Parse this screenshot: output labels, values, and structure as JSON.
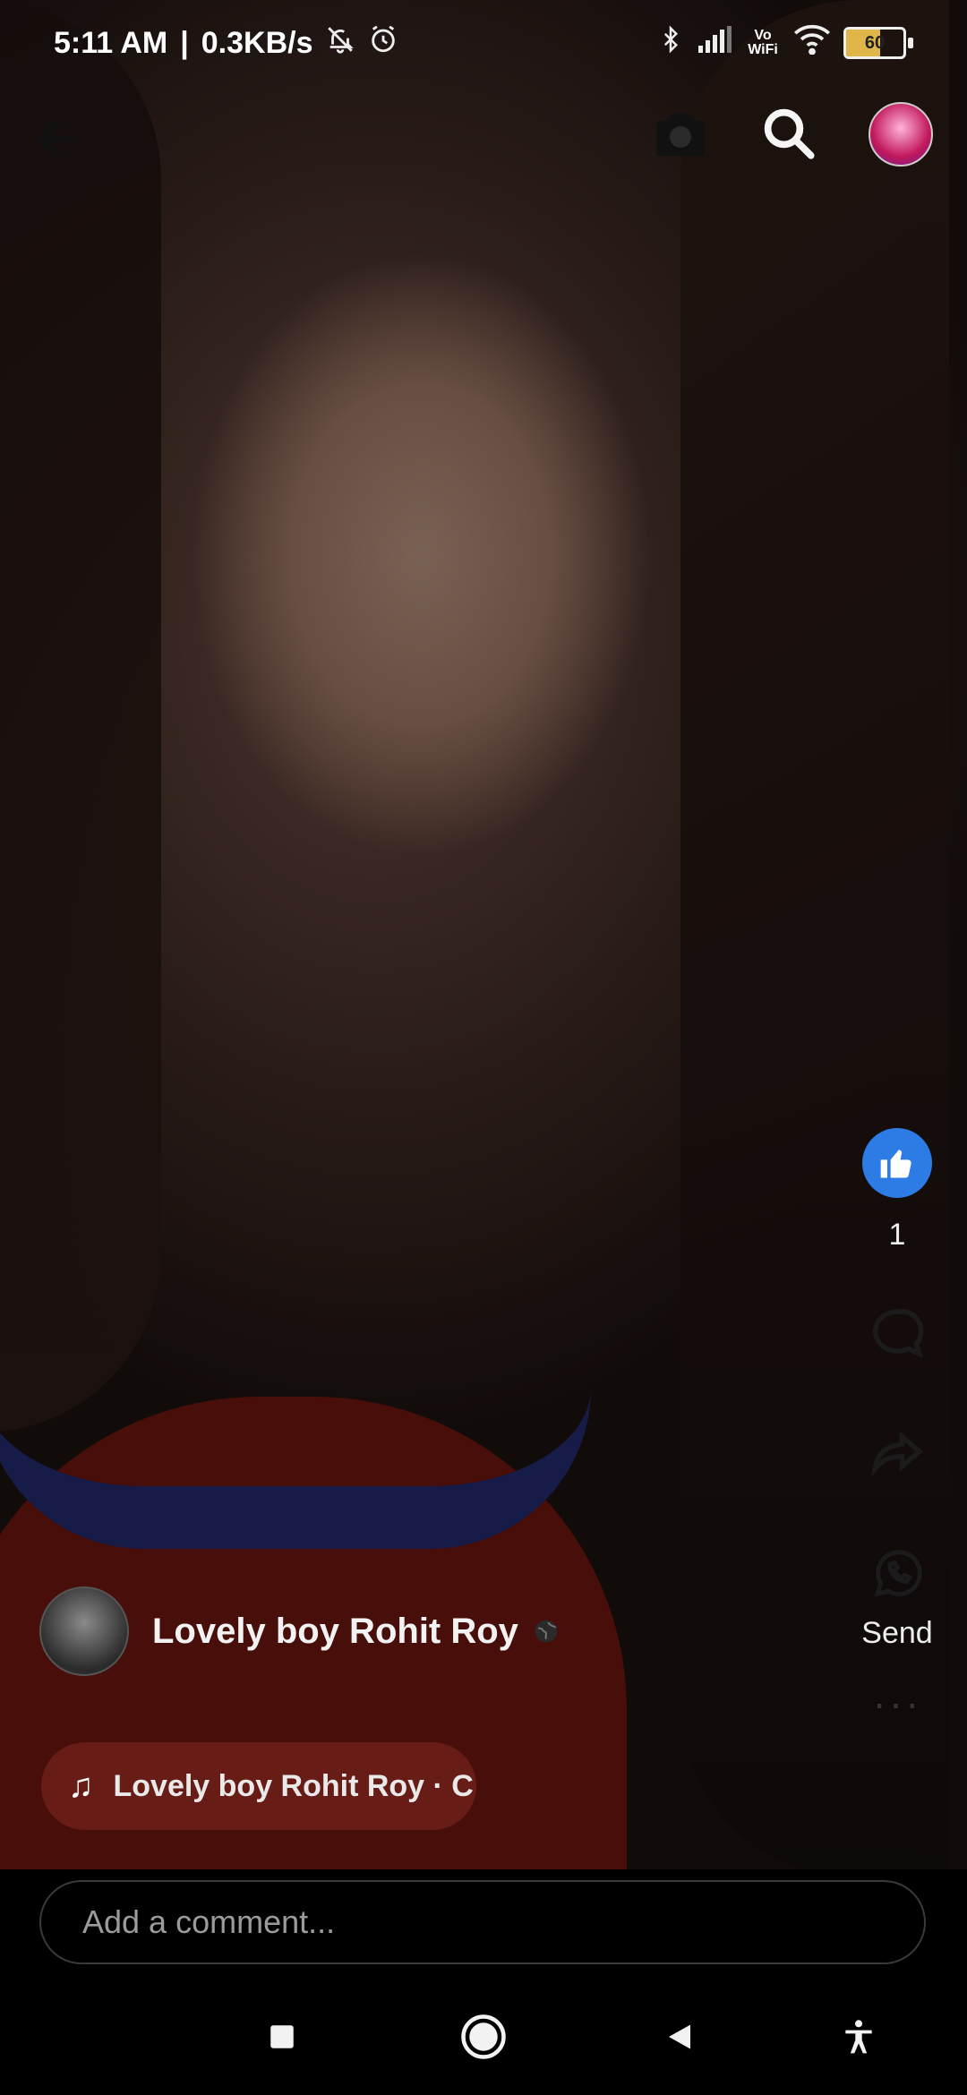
{
  "status_bar": {
    "time": "5:11 AM",
    "separator": "|",
    "speed": "0.3KB/s",
    "network_label": "Vo WiFi",
    "battery_level": "60",
    "battery_fraction": 0.6
  },
  "top_bar": {
    "icons": [
      "back-arrow-icon",
      "camera-icon",
      "search-icon",
      "profile-avatar"
    ]
  },
  "actions": {
    "like_count": "1",
    "send_label": "Send"
  },
  "post": {
    "author": "Lovely boy Rohit Roy",
    "music_text": "Lovely boy Rohit Roy · C"
  },
  "comment": {
    "placeholder": "Add a comment..."
  },
  "colors": {
    "like_blue": "#2d7be5",
    "music_pill": "#6e1e19",
    "battery_fill": "#e0b64b"
  }
}
